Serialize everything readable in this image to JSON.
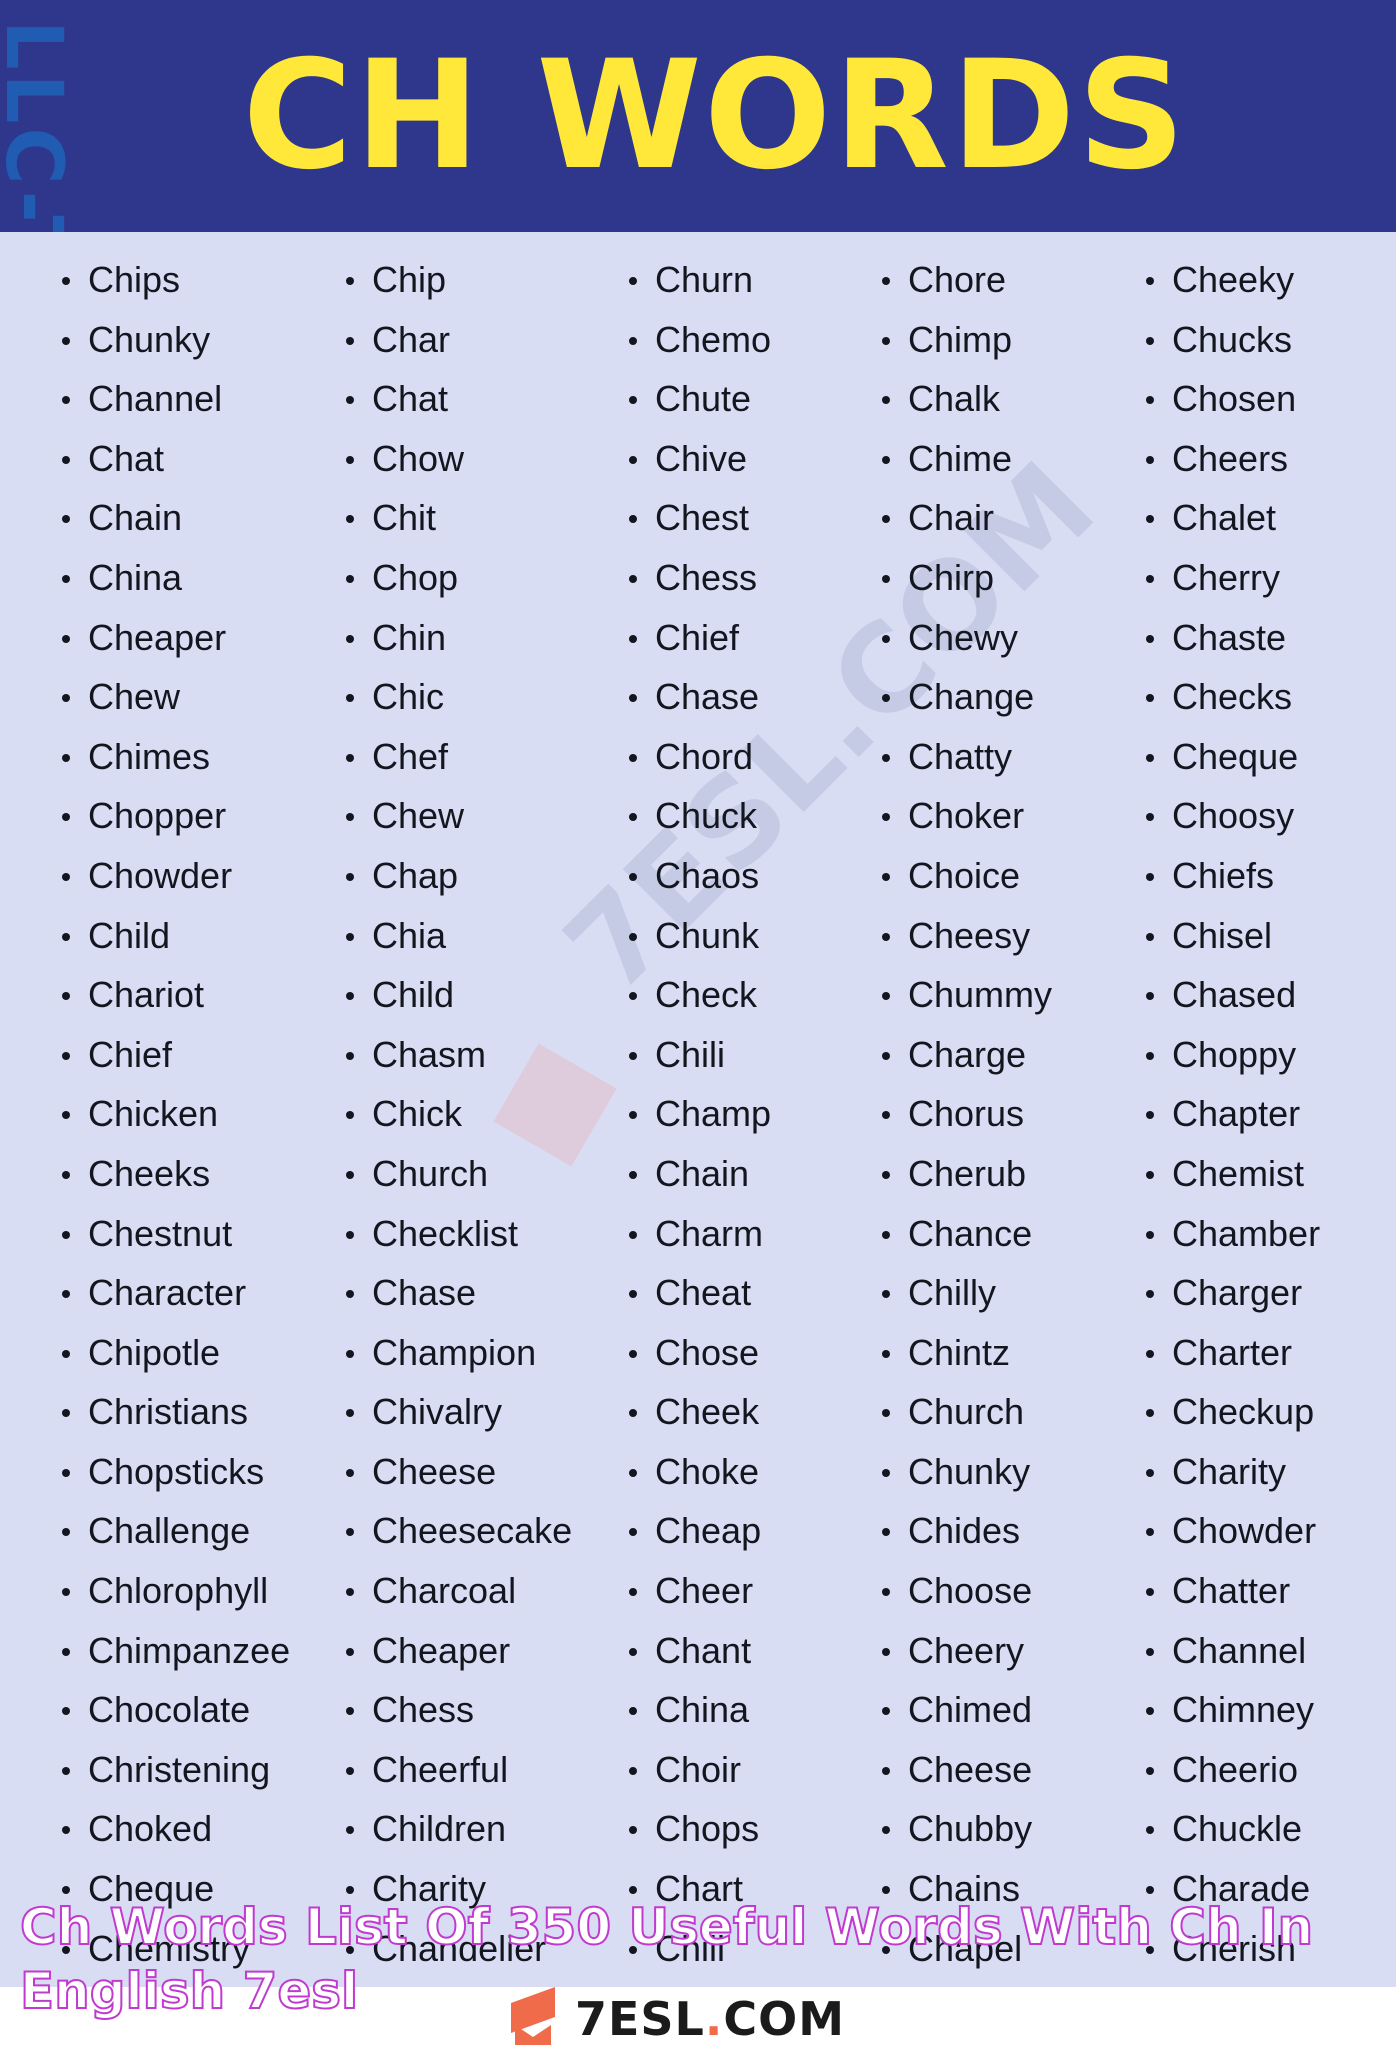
{
  "header": {
    "title": "CH WORDS",
    "side_mark": "LLC-TLD",
    "colors": {
      "background": "#2e378b",
      "title": "#ffe83a"
    }
  },
  "watermark": {
    "text": "7ESL.COM"
  },
  "columns": [
    {
      "words": [
        "Chips",
        "Chunky",
        "Channel",
        "Chat",
        "Chain",
        "China",
        "Cheaper",
        "Chew",
        "Chimes",
        "Chopper",
        "Chowder",
        "Child",
        "Chariot",
        "Chief",
        "Chicken",
        "Cheeks",
        "Chestnut",
        "Character",
        "Chipotle",
        "Christians",
        "Chopsticks",
        "Challenge",
        "Chlorophyll",
        "Chimpanzee",
        "Chocolate",
        "Christening",
        "Choked",
        "Cheque",
        "Chemistry"
      ]
    },
    {
      "words": [
        "Chip",
        "Char",
        "Chat",
        "Chow",
        "Chit",
        "Chop",
        "Chin",
        "Chic",
        "Chef",
        "Chew",
        "Chap",
        "Chia",
        "Child",
        "Chasm",
        "Chick",
        "Church",
        "Checklist",
        "Chase",
        "Champion",
        "Chivalry",
        "Cheese",
        "Cheesecake",
        "Charcoal",
        "Cheaper",
        "Chess",
        "Cheerful",
        "Children",
        "Charity",
        "Chandelier"
      ]
    },
    {
      "words": [
        "Churn",
        "Chemo",
        "Chute",
        "Chive",
        "Chest",
        "Chess",
        "Chief",
        "Chase",
        "Chord",
        "Chuck",
        "Chaos",
        "Chunk",
        "Check",
        "Chili",
        "Champ",
        "Chain",
        "Charm",
        "Cheat",
        "Chose",
        "Cheek",
        "Choke",
        "Cheap",
        "Cheer",
        "Chant",
        "China",
        "Choir",
        "Chops",
        "Chart",
        "Chill"
      ]
    },
    {
      "words": [
        "Chore",
        "Chimp",
        "Chalk",
        "Chime",
        "Chair",
        "Chirp",
        "Chewy",
        "Change",
        "Chatty",
        "Choker",
        "Choice",
        "Cheesy",
        "Chummy",
        "Charge",
        "Chorus",
        "Cherub",
        "Chance",
        "Chilly",
        "Chintz",
        "Church",
        "Chunky",
        "Chides",
        "Choose",
        "Cheery",
        "Chimed",
        "Cheese",
        "Chubby",
        "Chains",
        "Chapel"
      ]
    },
    {
      "words": [
        "Cheeky",
        "Chucks",
        "Chosen",
        "Cheers",
        "Chalet",
        "Cherry",
        "Chaste",
        "Checks",
        "Cheque",
        "Choosy",
        "Chiefs",
        "Chisel",
        "Chased",
        "Choppy",
        "Chapter",
        "Chemist",
        "Chamber",
        "Charger",
        "Charter",
        "Checkup",
        "Charity",
        "Chowder",
        "Chatter",
        "Channel",
        "Chimney",
        "Cheerio",
        "Chuckle",
        "Charade",
        "Cherish"
      ]
    }
  ],
  "caption": "Ch Words List Of 350 Useful Words With Ch In English 7esl",
  "footer": {
    "logo_text_main": "7ESL",
    "logo_text_dot": ".",
    "logo_text_end": "COM",
    "colors": {
      "accent": "#ef6b4a",
      "panel": "#d9ddf3"
    }
  }
}
